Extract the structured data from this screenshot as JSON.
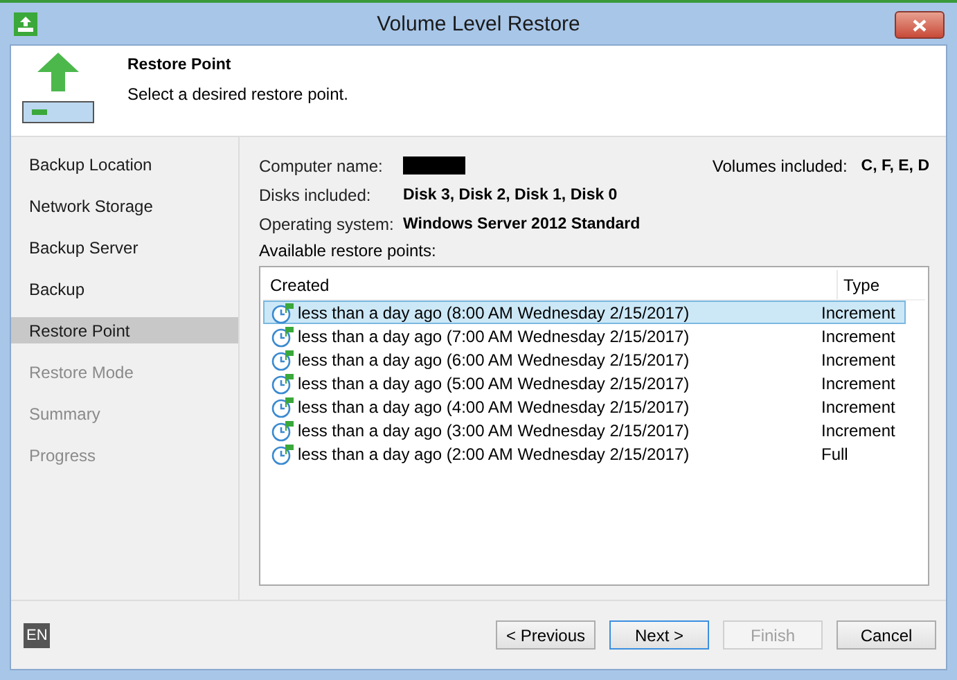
{
  "window": {
    "title": "Volume Level Restore"
  },
  "header": {
    "title": "Restore Point",
    "subtitle": "Select a desired restore point."
  },
  "sidebar": {
    "items": [
      {
        "label": "Backup Location",
        "selected": false,
        "disabled": false
      },
      {
        "label": "Network Storage",
        "selected": false,
        "disabled": false
      },
      {
        "label": "Backup Server",
        "selected": false,
        "disabled": false
      },
      {
        "label": "Backup",
        "selected": false,
        "disabled": false
      },
      {
        "label": "Restore Point",
        "selected": true,
        "disabled": false
      },
      {
        "label": "Restore Mode",
        "selected": false,
        "disabled": true
      },
      {
        "label": "Summary",
        "selected": false,
        "disabled": true
      },
      {
        "label": "Progress",
        "selected": false,
        "disabled": true
      }
    ]
  },
  "info": {
    "computer_name_label": "Computer name:",
    "computer_name_redacted": true,
    "volumes_label": "Volumes included:",
    "volumes": "C, F, E, D",
    "fields": [
      {
        "label": "Disks included:",
        "value": "Disk 3, Disk 2, Disk 1, Disk 0"
      },
      {
        "label": "Operating system:",
        "value": "Windows Server 2012 Standard"
      }
    ]
  },
  "restore_points": {
    "label": "Available restore points:",
    "columns": [
      "Created",
      "Type"
    ],
    "rows": [
      {
        "created": "less than a day ago (8:00 AM Wednesday 2/15/2017)",
        "type": "Increment",
        "selected": true
      },
      {
        "created": "less than a day ago (7:00 AM Wednesday 2/15/2017)",
        "type": "Increment",
        "selected": false
      },
      {
        "created": "less than a day ago (6:00 AM Wednesday 2/15/2017)",
        "type": "Increment",
        "selected": false
      },
      {
        "created": "less than a day ago (5:00 AM Wednesday 2/15/2017)",
        "type": "Increment",
        "selected": false
      },
      {
        "created": "less than a day ago (4:00 AM Wednesday 2/15/2017)",
        "type": "Increment",
        "selected": false
      },
      {
        "created": "less than a day ago (3:00 AM Wednesday 2/15/2017)",
        "type": "Increment",
        "selected": false
      },
      {
        "created": "less than a day ago (2:00 AM Wednesday 2/15/2017)",
        "type": "Full",
        "selected": false
      }
    ]
  },
  "footer": {
    "language": "EN",
    "buttons": [
      {
        "label": "< Previous",
        "disabled": false,
        "default": false
      },
      {
        "label": "Next >",
        "disabled": false,
        "default": true
      },
      {
        "label": "Finish",
        "disabled": true,
        "default": false
      },
      {
        "label": "Cancel",
        "disabled": false,
        "default": false
      }
    ]
  }
}
